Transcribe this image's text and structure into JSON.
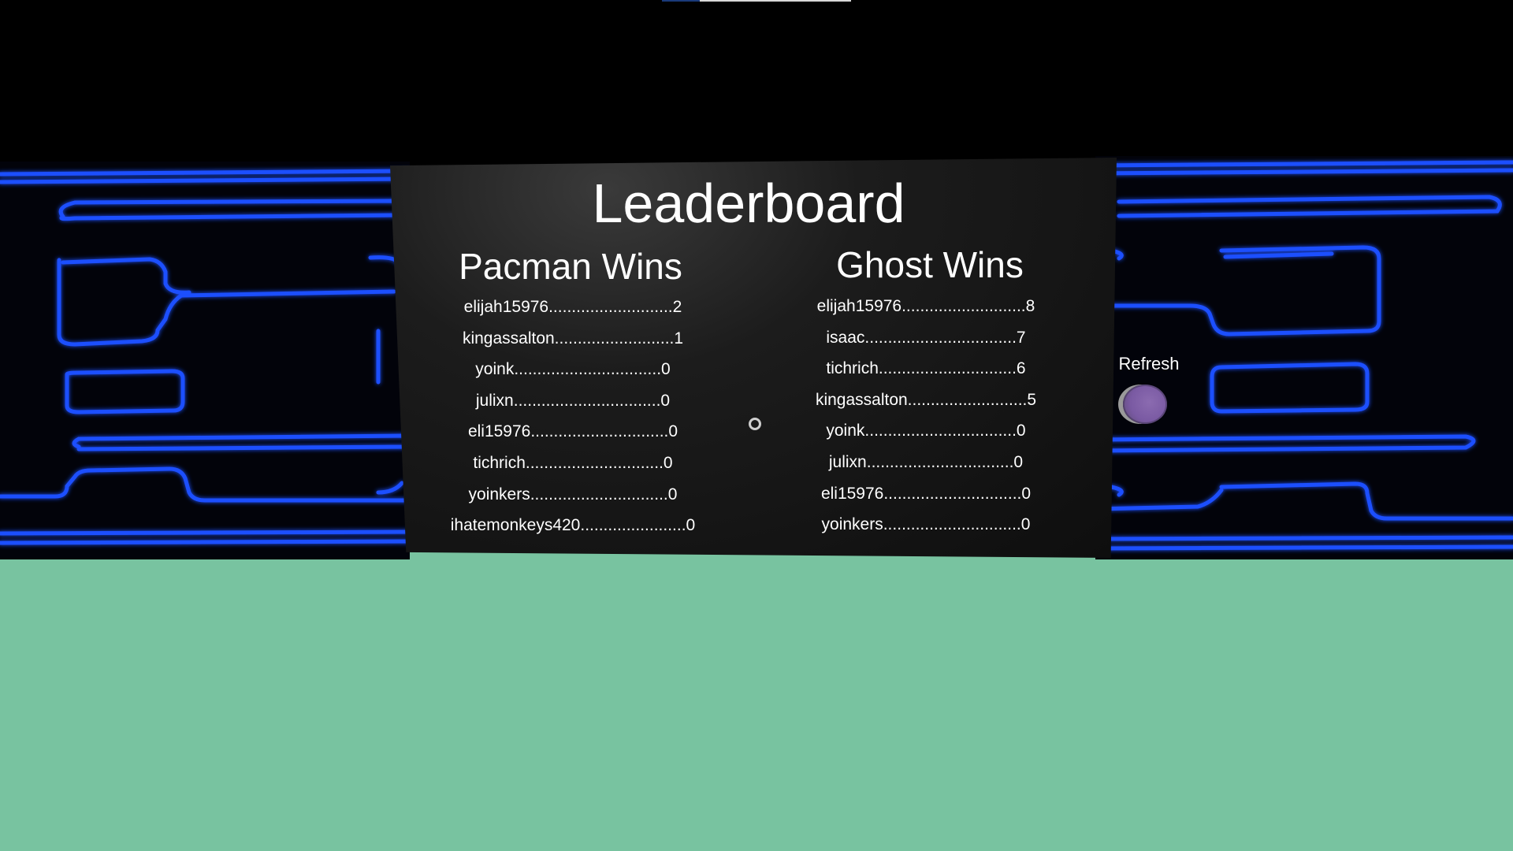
{
  "leaderboard": {
    "title": "Leaderboard",
    "pacman": {
      "title": "Pacman Wins",
      "entries": [
        "elijah15976...........................2",
        "kingassalton..........................1",
        "yoink................................0",
        "julixn................................0",
        "eli15976..............................0",
        "tichrich..............................0",
        "yoinkers..............................0",
        "ihatemonkeys420.......................0"
      ]
    },
    "ghost": {
      "title": "Ghost Wins",
      "entries": [
        "elijah15976...........................8",
        "isaac.................................7",
        "tichrich..............................6",
        "kingassalton..........................5",
        "yoink.................................0",
        "julixn................................0",
        "eli15976..............................0",
        "yoinkers..............................0"
      ]
    }
  },
  "refresh": {
    "label": "Refresh"
  },
  "colors": {
    "sky": "#000000",
    "floor": "#78c3a0",
    "wall_line": "#1e4fff",
    "board": "#151515",
    "button": "#7a5aa3"
  },
  "icons": {
    "reticle": "crosshair-ring-icon"
  }
}
